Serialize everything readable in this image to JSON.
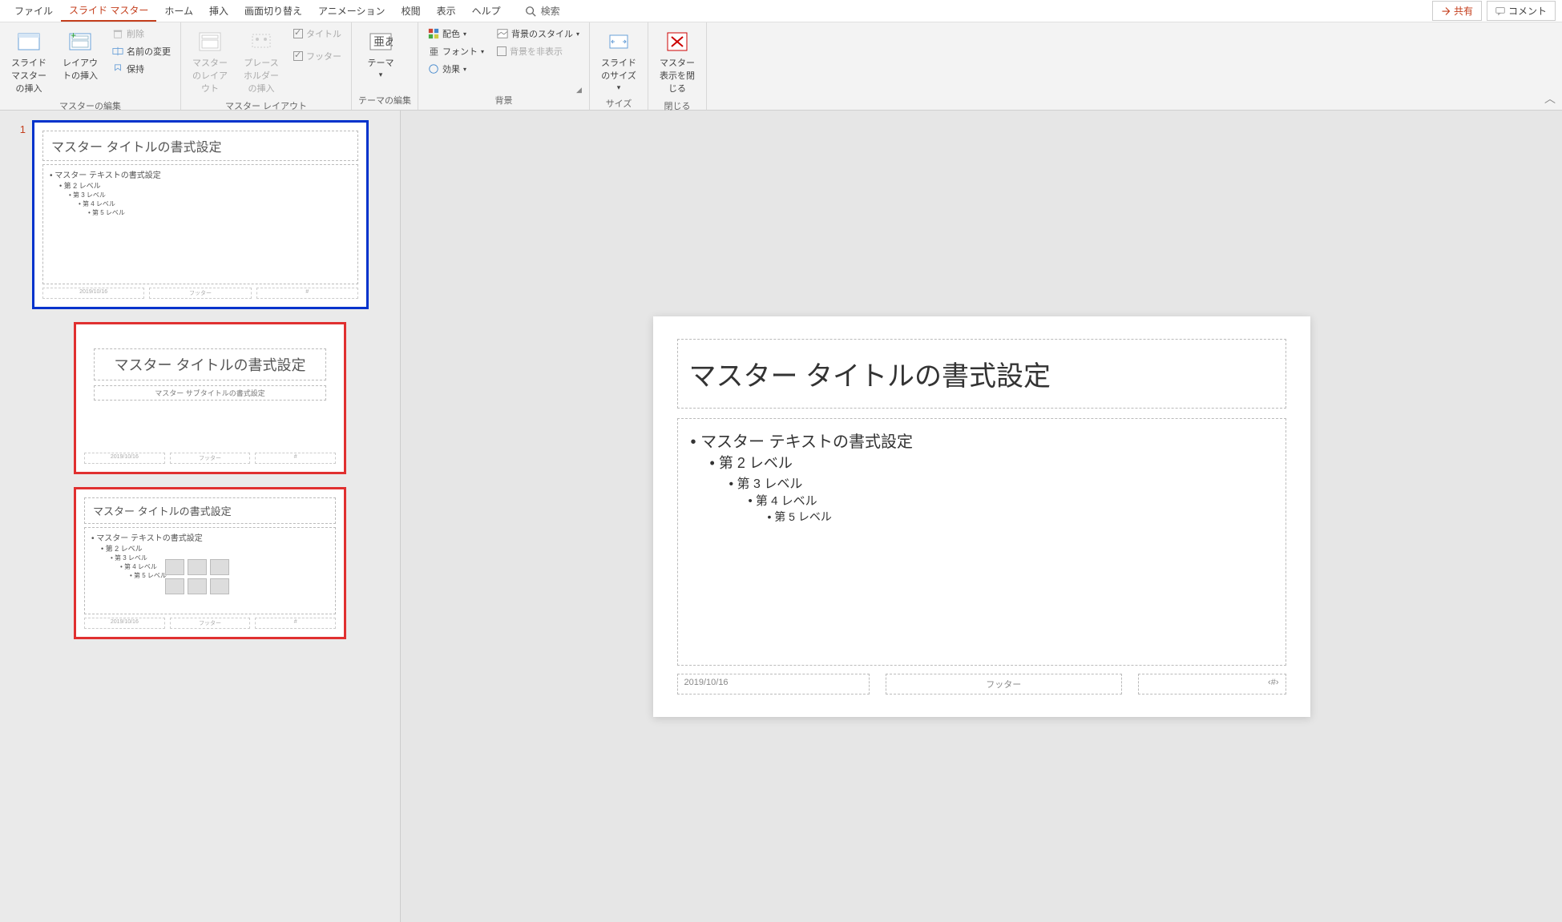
{
  "menu": {
    "tabs": [
      "ファイル",
      "スライド マスター",
      "ホーム",
      "挿入",
      "画面切り替え",
      "アニメーション",
      "校閲",
      "表示",
      "ヘルプ"
    ],
    "active_index": 1,
    "search_label": "検索",
    "share_label": "共有",
    "comment_label": "コメント"
  },
  "ribbon": {
    "groups": {
      "master_edit": {
        "label": "マスターの編集",
        "insert_master": "スライド マスターの挿入",
        "insert_layout": "レイアウトの挿入",
        "delete": "削除",
        "rename": "名前の変更",
        "preserve": "保持"
      },
      "master_layout": {
        "label": "マスター レイアウト",
        "master_layout_btn": "マスターのレイアウト",
        "insert_placeholder": "プレースホルダーの挿入",
        "title_chk": "タイトル",
        "footer_chk": "フッター"
      },
      "theme_edit": {
        "label": "テーマの編集",
        "theme": "テーマ"
      },
      "background": {
        "label": "背景",
        "colors": "配色",
        "fonts": "フォント",
        "effects": "効果",
        "bg_styles": "背景のスタイル",
        "hide_bg": "背景を非表示"
      },
      "size": {
        "label": "サイズ",
        "slide_size": "スライドのサイズ"
      },
      "close": {
        "label": "閉じる",
        "close_master": "マスター表示を閉じる"
      }
    }
  },
  "thumbnails": {
    "master_number": "1",
    "master": {
      "title": "マスター タイトルの書式設定",
      "body_l1": "マスター テキストの書式設定",
      "body_l2": "第 2 レベル",
      "body_l3": "第 3 レベル",
      "body_l4": "第 4 レベル",
      "body_l5": "第 5 レベル",
      "date": "2019/10/16",
      "footer": "フッター",
      "page": "#"
    },
    "layout1": {
      "title": "マスター タイトルの書式設定",
      "subtitle": "マスター サブタイトルの書式設定",
      "date": "2019/10/16",
      "footer": "フッター",
      "page": "#"
    },
    "layout2": {
      "title": "マスター タイトルの書式設定",
      "body_l1": "マスター テキストの書式設定",
      "body_l2": "第 2 レベル",
      "body_l3": "第 3 レベル",
      "body_l4": "第 4 レベル",
      "body_l5": "第 5 レベル",
      "date": "2019/10/16",
      "footer": "フッター",
      "page": "#"
    }
  },
  "slide": {
    "title": "マスター タイトルの書式設定",
    "body_l1": "マスター テキストの書式設定",
    "body_l2": "第 2 レベル",
    "body_l3": "第 3 レベル",
    "body_l4": "第 4 レベル",
    "body_l5": "第 5 レベル",
    "date": "2019/10/16",
    "footer": "フッター",
    "page": "‹#›"
  }
}
